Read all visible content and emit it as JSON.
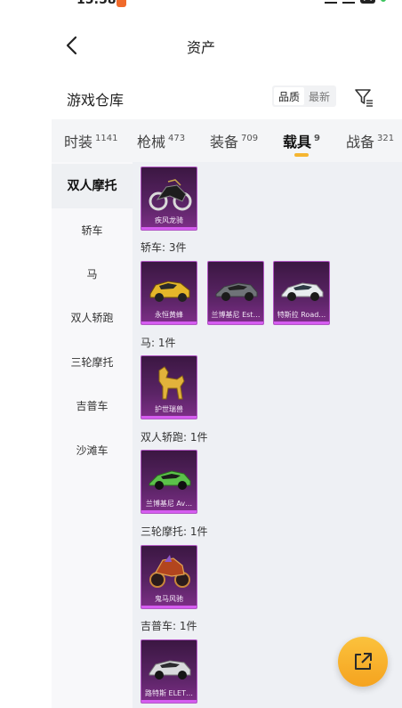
{
  "status": {
    "time": "15:58",
    "battery": "74"
  },
  "header": {
    "title": "资产"
  },
  "warehouse": {
    "title": "游戏仓库",
    "sort_options": [
      "品质",
      "最新"
    ]
  },
  "tabs": [
    {
      "label": "时装",
      "count": "1141"
    },
    {
      "label": "枪械",
      "count": "473"
    },
    {
      "label": "装备",
      "count": "709"
    },
    {
      "label": "载具",
      "count": "9"
    },
    {
      "label": "战备",
      "count": "321"
    }
  ],
  "sidebar": {
    "items": [
      {
        "label": "双人摩托"
      },
      {
        "label": "轿车"
      },
      {
        "label": "马"
      },
      {
        "label": "双人轿跑"
      },
      {
        "label": "三轮摩托"
      },
      {
        "label": "吉普车"
      },
      {
        "label": "沙滩车"
      }
    ]
  },
  "groups": {
    "sedan": "轿车: 3件",
    "horse": "马: 1件",
    "coupe": "双人轿跑: 1件",
    "trike": "三轮摩托: 1件",
    "jeep": "吉普车: 1件"
  },
  "items": {
    "moto": "疾风龙骑",
    "sedan1": "永恒黄蜂",
    "sedan2": "兰博基尼 Est…",
    "sedan3": "特斯拉 Road…",
    "horse": "护世瑞兽",
    "coupe": "兰博基尼 Av…",
    "trike": "鬼马风驰",
    "jeep": "路特斯 ELET…"
  },
  "colors": {
    "accent": "#f5b531",
    "card": "#5b2466",
    "card_border": "#d55cf0"
  }
}
